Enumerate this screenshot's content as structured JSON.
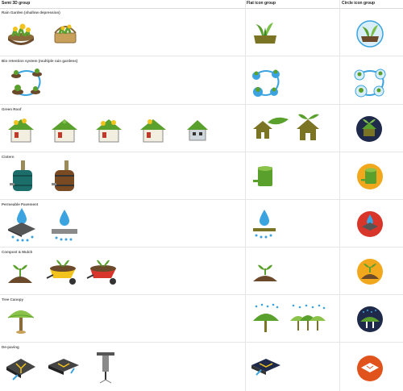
{
  "columns": {
    "semi3d": "Semi 3D group",
    "flat": "Flat icon group",
    "circle": "Circle icon group"
  },
  "rows": [
    {
      "label": "Rain Garden (shallow depression)"
    },
    {
      "label": "Bio retention system (multiple rain gardens)"
    },
    {
      "label": "Green Roof"
    },
    {
      "label": "Cistern"
    },
    {
      "label": "Permeable Pavement"
    },
    {
      "label": "Compost & Mulch"
    },
    {
      "label": "Tree Canopy"
    },
    {
      "label": "De-paving"
    }
  ],
  "colors": {
    "olive": "#7a7424",
    "green": "#5aa02c",
    "water": "#3aa3e0",
    "soil": "#6b4a2b",
    "navy": "#1f2a4a",
    "orange": "#f2a81d",
    "red": "#d9362b",
    "sky": "#d9eefb",
    "deepOrange": "#e0531c"
  }
}
